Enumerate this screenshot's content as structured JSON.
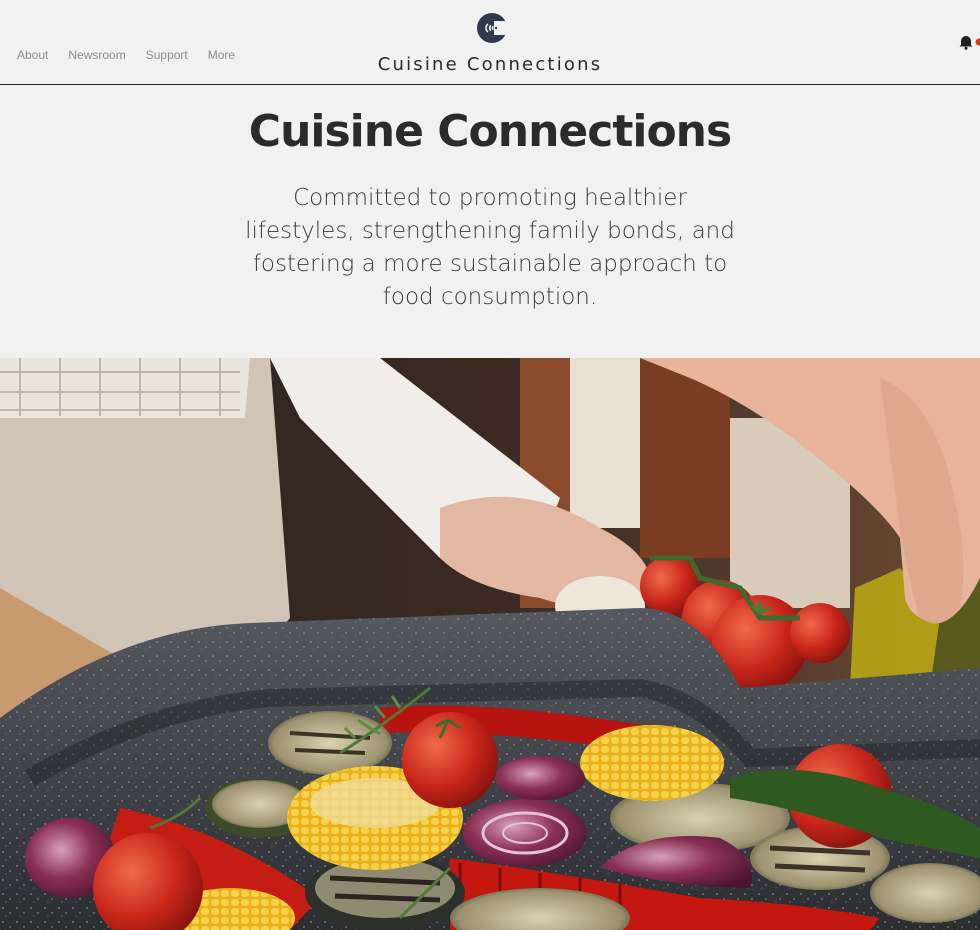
{
  "nav": {
    "items": [
      "About",
      "Newsroom",
      "Support",
      "More"
    ]
  },
  "header": {
    "brand_name": "Cuisine Connections",
    "logo_icon": "cc-logo-icon",
    "notification_icon": "bell-icon"
  },
  "hero": {
    "title": "Cuisine Connections",
    "tagline": "Committed to promoting healthier lifestyles, strengthening family bonds, and fostering a more sustainable approach to food consumption."
  },
  "colors": {
    "background": "#f1f1f1",
    "text_dark": "#2b2b2b",
    "nav_text": "#8d8d8d",
    "logo": "#2f3b4b"
  }
}
